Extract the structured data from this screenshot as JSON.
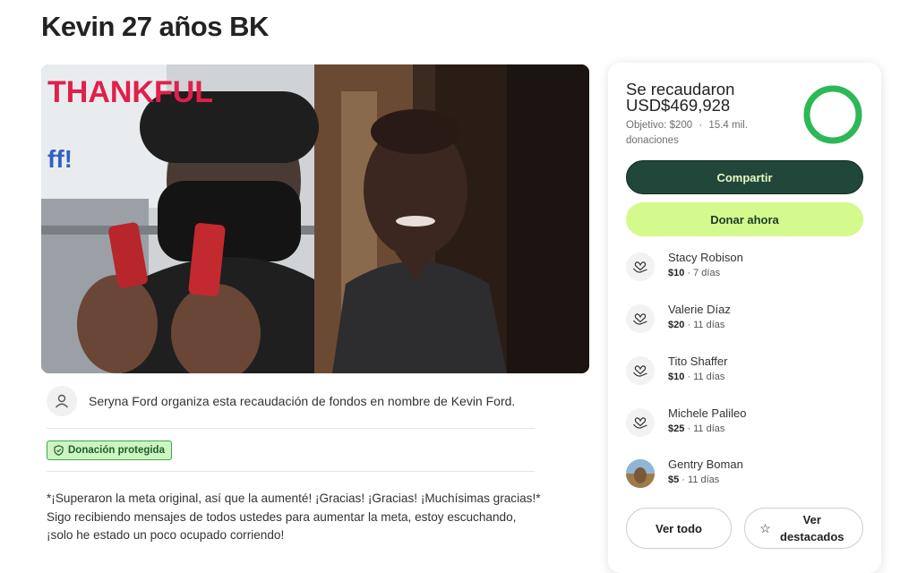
{
  "page": {
    "title": "Kevin 27 años BK"
  },
  "photo": {
    "sign_text": "THANKFUL",
    "sign_text_2": "ff!"
  },
  "organizer": {
    "text": "Seryna Ford organiza esta recaudación de fondos en nombre de Kevin Ford."
  },
  "badge": {
    "label": "Donación protegida"
  },
  "story": {
    "line1": "*¡Superaron la meta original, así que la aumenté! ¡Gracias! ¡Gracias! ¡Muchísimas gracias!*",
    "line2": "Sigo recibiendo mensajes de todos ustedes para aumentar la meta, estoy escuchando,",
    "line3": "¡solo he estado un poco ocupado corriendo!"
  },
  "card": {
    "raised_label": "Se recaudaron",
    "raised_amount": "USD$469,928",
    "goal": "Objetivo: $200",
    "separator": "·",
    "donations_count": "15.4 mil. donaciones",
    "progress_fraction": 1.0,
    "share_label": "Compartir",
    "donate_label": "Donar ahora",
    "see_all_label": "Ver todo",
    "see_featured_label": "Ver destacados",
    "star_glyph": "☆",
    "colors": {
      "ring": "#2db856",
      "share_bg": "#20473a",
      "donate_bg": "#d4f98c"
    }
  },
  "donations": [
    {
      "name": "Stacy Robison",
      "amount": "$10",
      "time": " · 7 días",
      "icon": "heart-hand-icon"
    },
    {
      "name": "Valerie Díaz",
      "amount": "$20",
      "time": " · 11 días",
      "icon": "heart-hand-icon"
    },
    {
      "name": "Tito Shaffer",
      "amount": "$10",
      "time": " · 11 días",
      "icon": "heart-hand-icon"
    },
    {
      "name": "Michele Palileo",
      "amount": "$25",
      "time": " · 11 días",
      "icon": "heart-hand-icon"
    },
    {
      "name": "Gentry Boman",
      "amount": "$5",
      "time": " · 11 días",
      "icon": "avatar-photo"
    }
  ]
}
